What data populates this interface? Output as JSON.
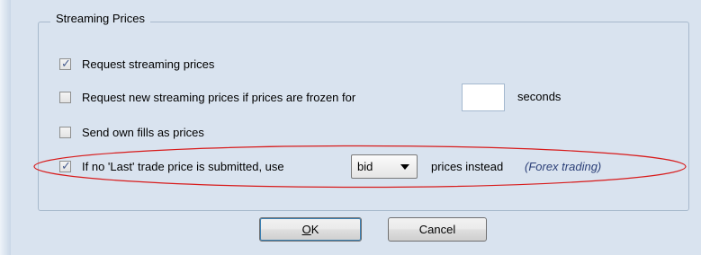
{
  "group": {
    "title": "Streaming Prices"
  },
  "options": {
    "request_streaming": {
      "label": "Request streaming prices",
      "checked": true
    },
    "request_new_if_frozen": {
      "label": "Request new streaming prices if prices are frozen for",
      "checked": false,
      "value": "",
      "unit": "seconds"
    },
    "send_own_fills": {
      "label": "Send own fills as prices",
      "checked": false
    },
    "no_last_price": {
      "label": "If no 'Last' trade price is submitted, use",
      "checked": true,
      "selected_price": "bid",
      "suffix": "prices instead",
      "note": "(Forex trading)"
    }
  },
  "buttons": {
    "ok_underlined": "O",
    "ok_rest": "K",
    "cancel": "Cancel"
  },
  "colors": {
    "highlight_ellipse": "#d81b1b",
    "background": "#d9e3ef",
    "note_text": "#2b3f77"
  }
}
